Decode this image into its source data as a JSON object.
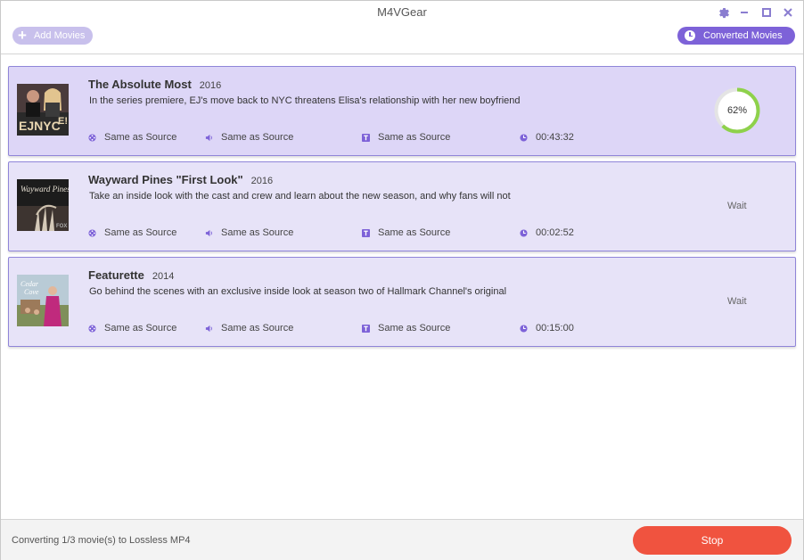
{
  "window": {
    "title": "M4VGear"
  },
  "toolbar": {
    "add_movies_label": "Add Movies",
    "converted_movies_label": "Converted Movies"
  },
  "colors": {
    "accent": "#7d62d8",
    "active_card": "#ddd6f7",
    "waiting_card": "#e7e3f8",
    "progress": "#8ed14b",
    "stop": "#f0533f"
  },
  "movies": [
    {
      "title": "The Absolute Most",
      "year": "2016",
      "description": "In the series premiere, EJ's move back to NYC threatens Elisa's relationship with her new boyfriend",
      "video": "Same as Source",
      "audio": "Same as Source",
      "subtitle": "Same as Source",
      "duration": "00:43:32",
      "progress_label": "62%",
      "progress_value": 0.62,
      "status": ""
    },
    {
      "title": "Wayward Pines \"First Look\"",
      "year": "2016",
      "description": "Take an inside look with the cast and crew and learn about the new season, and why fans will not",
      "video": "Same as Source",
      "audio": "Same as Source",
      "subtitle": "Same as Source",
      "duration": "00:02:52",
      "status": "Wait"
    },
    {
      "title": "Featurette",
      "year": "2014",
      "description": "Go behind the scenes with an exclusive inside look at season two of Hallmark Channel's original",
      "video": "Same as Source",
      "audio": "Same as Source",
      "subtitle": "Same as Source",
      "duration": "00:15:00",
      "status": "Wait"
    }
  ],
  "footer": {
    "status_text": "Converting 1/3 movie(s) to Lossless MP4",
    "stop_label": "Stop"
  }
}
